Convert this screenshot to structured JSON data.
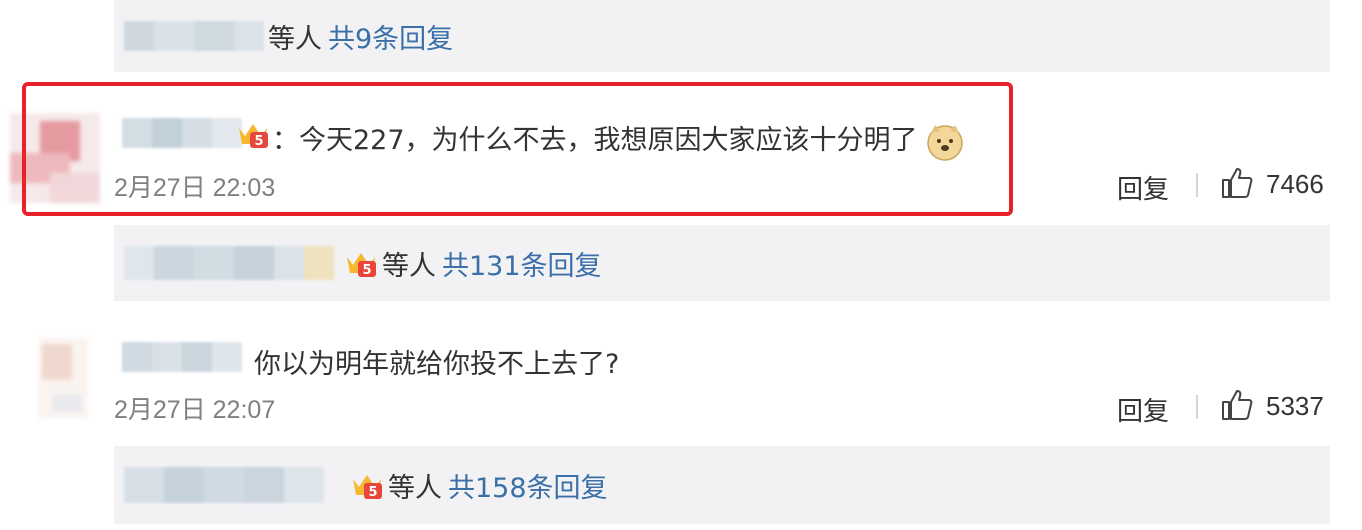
{
  "reply_bar_1": {
    "etc": "等人",
    "more": "共9条回复"
  },
  "comment_1": {
    "text": "：今天227，为什么不去，我想原因大家应该十分明了",
    "time": "2月27日 22:03",
    "reply_label": "回复",
    "likes": "7466"
  },
  "reply_bar_2": {
    "etc": "等人",
    "more": "共131条回复"
  },
  "comment_2": {
    "text": "你以为明年就给你投不上去了?",
    "time": "2月27日 22:07",
    "reply_label": "回复",
    "likes": "5337"
  },
  "reply_bar_3": {
    "etc": "等人",
    "more": "共158条回复"
  },
  "colors": {
    "link": "#3b6fa8",
    "highlight": "#e8222b",
    "bar_bg": "#f2f2f4",
    "meta": "#808080"
  },
  "icons": [
    "vip-crown-icon",
    "doge-emoji-icon",
    "thumbs-up-icon"
  ]
}
